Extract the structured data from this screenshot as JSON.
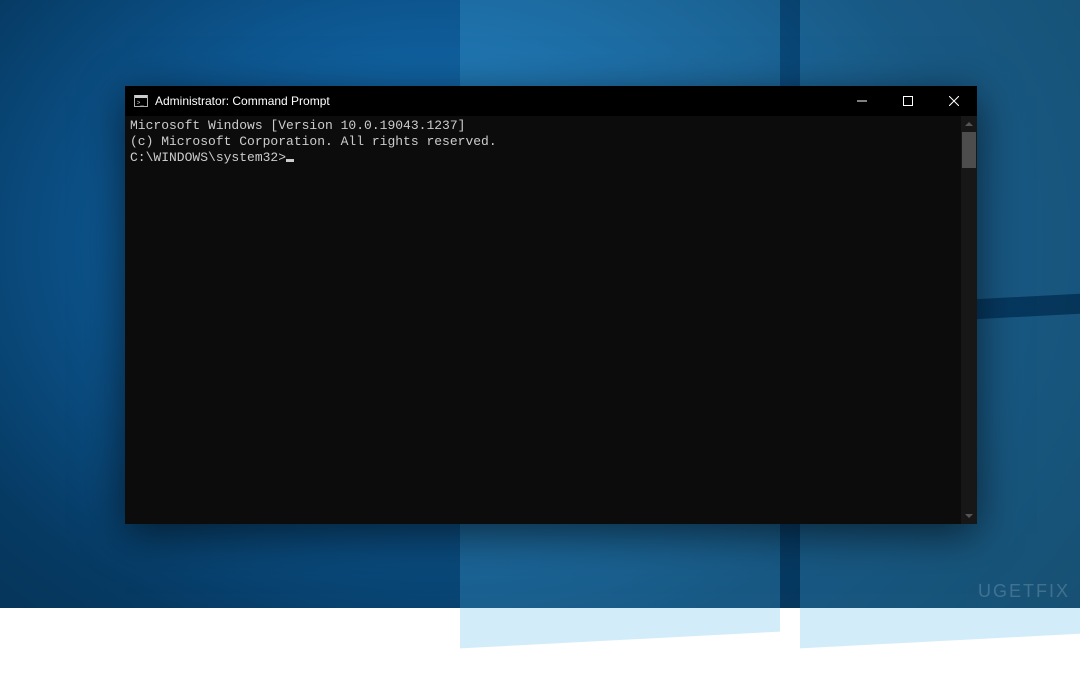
{
  "window": {
    "title": "Administrator: Command Prompt"
  },
  "terminal": {
    "line1": "Microsoft Windows [Version 10.0.19043.1237]",
    "line2": "(c) Microsoft Corporation. All rights reserved.",
    "blank": "",
    "prompt": "C:\\WINDOWS\\system32>"
  },
  "watermark": {
    "text": "UGETFIX"
  }
}
